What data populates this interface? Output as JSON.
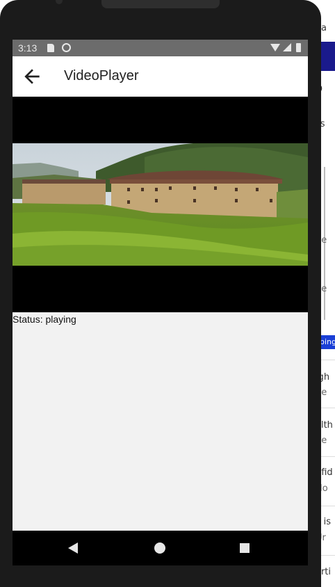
{
  "status_bar": {
    "time": "3:13",
    "icons": [
      "sd-card-icon",
      "sync-icon",
      "wifi-icon",
      "signal-icon",
      "battery-icon"
    ]
  },
  "app_bar": {
    "title": "VideoPlayer",
    "back_icon": "arrow-left-icon"
  },
  "video": {
    "thumbnail": "rural-earthen-building-in-rice-fields"
  },
  "player": {
    "status": "Status: playing"
  },
  "nav_bar": {
    "buttons": [
      "back-triangle-icon",
      "home-circle-icon",
      "recents-square-icon"
    ]
  },
  "background_page": {
    "fragments": [
      "ea",
      "D",
      "ss",
      "e",
      "ne",
      "ne",
      "e",
      "bing",
      "igh",
      "ne",
      "alth",
      "ne",
      "nfid",
      "No",
      "k is",
      "Ur",
      "arti"
    ]
  },
  "colors": {
    "status_bar_bg": "#6c6c6c",
    "app_bar_bg": "#ffffff",
    "screen_bg": "#f2f2f2",
    "nav_bar_bg": "#000000",
    "pill_blue": "#1a3fd6"
  }
}
